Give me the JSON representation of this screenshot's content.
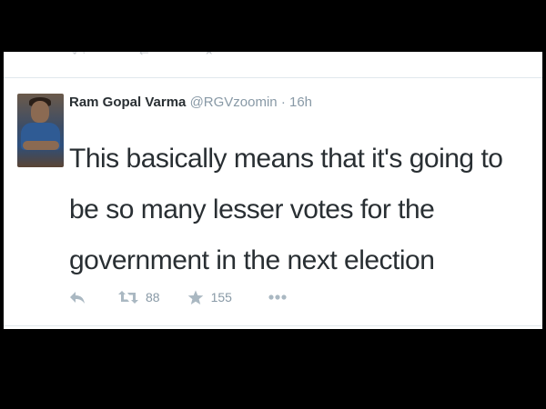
{
  "tweet": {
    "display_name": "Ram Gopal Varma",
    "handle": "@RGVzoomin",
    "separator": "·",
    "timestamp": "16h",
    "text": "This basically means that it's going to be so many lesser votes for the government in the next election",
    "retweet_count": "88",
    "favorite_count": "155"
  },
  "icons": {
    "reply": "reply-icon",
    "retweet": "retweet-icon",
    "favorite": "star-icon",
    "more": "more-dots-icon",
    "avatar": "avatar"
  },
  "colors": {
    "background": "#000000",
    "card": "#ffffff",
    "text": "#292f33",
    "meta": "#8899a6",
    "icon": "#aab8c2",
    "border": "#e1e8ed"
  }
}
